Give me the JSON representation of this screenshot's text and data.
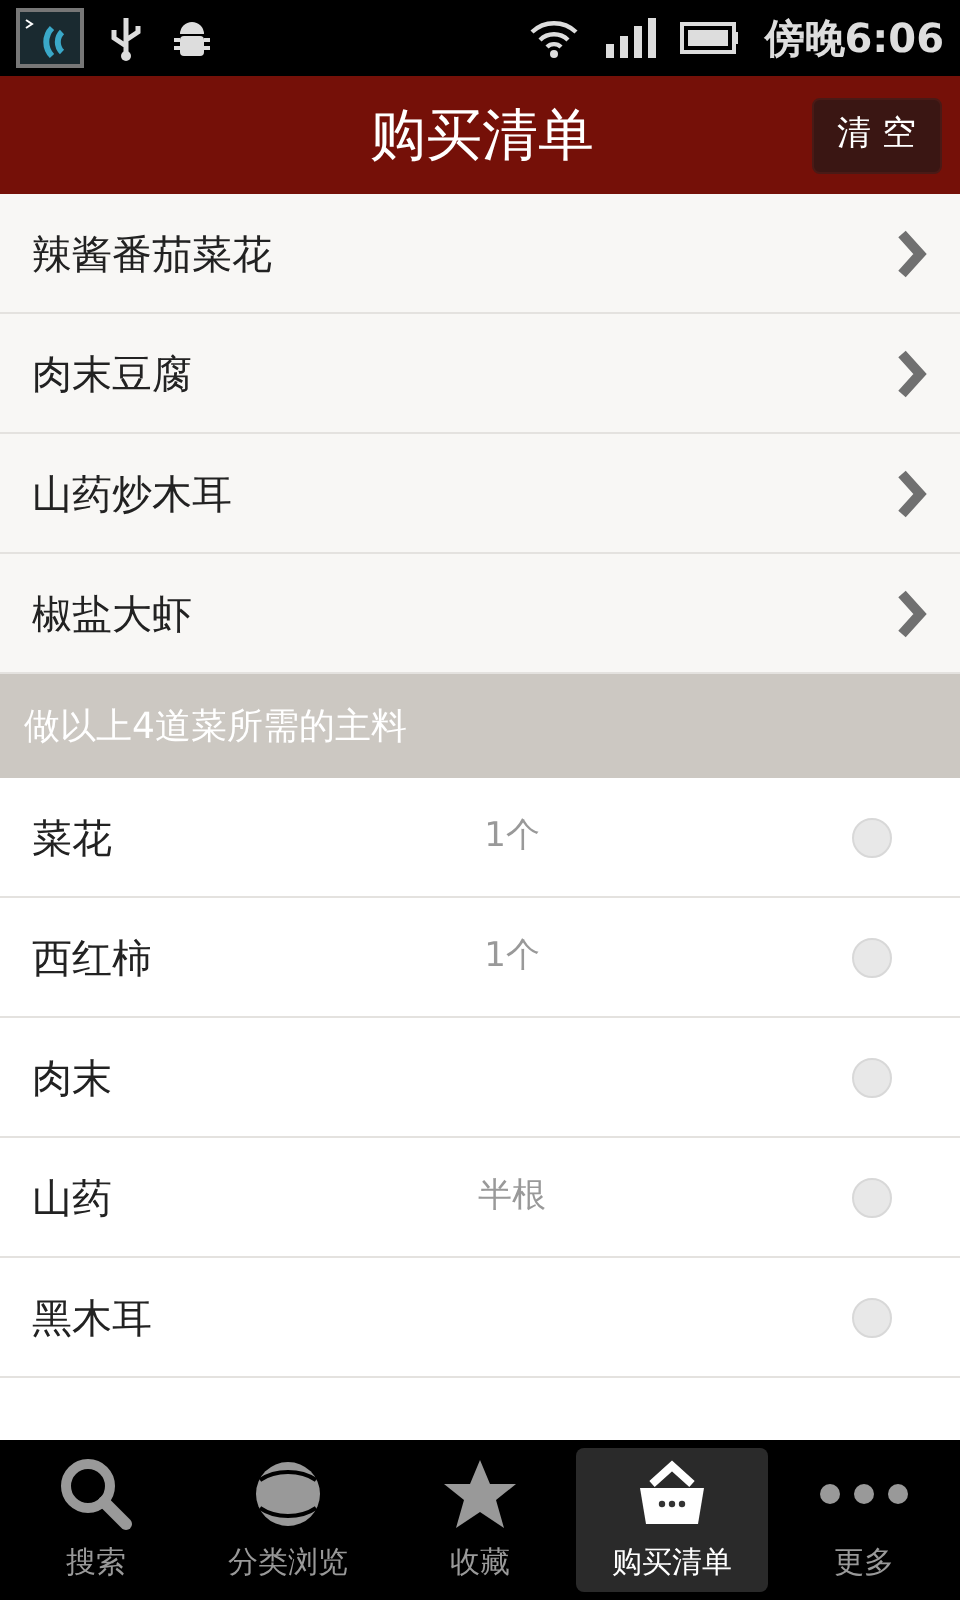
{
  "status_bar": {
    "time": "傍晚6:06"
  },
  "header": {
    "title": "购买清单",
    "clear_button": "清 空"
  },
  "dishes": [
    {
      "name": "辣酱番茄菜花"
    },
    {
      "name": "肉末豆腐"
    },
    {
      "name": "山药炒木耳"
    },
    {
      "name": "椒盐大虾"
    }
  ],
  "section_header": "做以上4道菜所需的主料",
  "ingredients": [
    {
      "name": "菜花",
      "amount": "1个",
      "checked": false
    },
    {
      "name": "西红柿",
      "amount": "1个",
      "checked": false
    },
    {
      "name": "肉末",
      "checked": false
    },
    {
      "name": "山药",
      "amount": "半根",
      "checked": false
    },
    {
      "name": "黑木耳",
      "checked": false
    }
  ],
  "tabs": [
    {
      "label": "搜索",
      "kind": "search",
      "selected": false
    },
    {
      "label": "分类浏览",
      "kind": "browse",
      "selected": false
    },
    {
      "label": "收藏",
      "kind": "favorite",
      "selected": false
    },
    {
      "label": "购买清单",
      "kind": "basket",
      "selected": true
    },
    {
      "label": "更多",
      "kind": "more",
      "selected": false
    }
  ]
}
